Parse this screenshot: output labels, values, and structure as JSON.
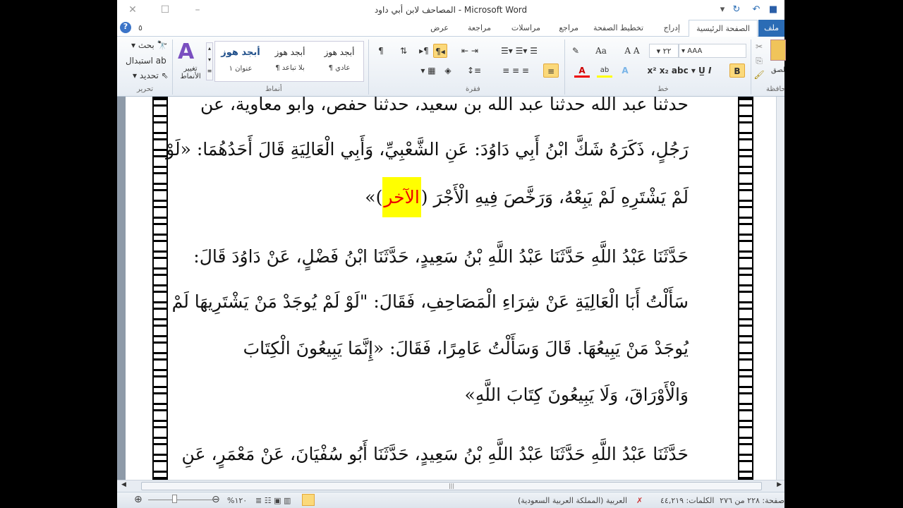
{
  "window": {
    "title": "المصاحف لابن أبي داود - Microsoft Word"
  },
  "tabs": [
    "ملف",
    "الصفحة الرئيسية",
    "إدراج",
    "تخطيط الصفحة",
    "مراجع",
    "مراسلات",
    "مراجعة",
    "عرض"
  ],
  "ribbon": {
    "editing": {
      "find": "بحث",
      "replace": "استبدال",
      "select": "تحديد",
      "label": "تحرير"
    },
    "styles": {
      "change_styles": "تغيير الأنماط",
      "label": "أنماط",
      "items": [
        {
          "sample": "أبجد هوز",
          "name": "¶ عادي"
        },
        {
          "sample": "أبجد هوز",
          "name": "¶ بلا تباعد"
        },
        {
          "sample": "أبجد هوز",
          "name": "عنوان ١"
        }
      ]
    },
    "paragraph": {
      "label": "فقرة"
    },
    "font": {
      "label": "خط",
      "name": "AAA GoldenLotus",
      "size": "٢٢"
    },
    "clipboard": {
      "label": "حافظة",
      "paste": "لصق"
    },
    "help_num": "٥"
  },
  "document": {
    "lines": [
      "حدثنا عبد الله حدثنا عبد الله بن سعيد، حدثنا حفص، وأبو معاوية، عن",
      "رَجُلٍ، ذَكَرَهُ شَكَّ ابْنُ أَبِي دَاوُدَ: عَنِ الشَّعْبِيِّ، وَأَبِي الْعَالِيَةِ قَالَ أَحَدُهُمَا: «لَوْ",
      "لَمْ يَشْتَرِهِ لَمْ يَبِعْهُ، وَرَخَّصَ فِيهِ الْأَجْرَ (",
      "حَدَّثَنَا عَبْدُ اللَّهِ حَدَّثَنَا عَبْدُ اللَّهِ بْنُ سَعِيدٍ، حَدَّثَنَا ابْنُ فَضْلٍ، عَنْ دَاوُدَ قَالَ:",
      "سَأَلْتُ أَبَا الْعَالِيَةِ عَنْ شِرَاءِ الْمَصَاحِفِ، فَقَالَ: \"لَوْ لَمْ يُوجَدْ مَنْ يَشْتَرِيهَا لَمْ",
      "يُوجَدْ مَنْ يَبِيعُهَا. قَالَ وَسَأَلْتُ عَامِرًا، فَقَالَ: «إِنَّمَا يَبِيعُونَ الْكِتَابَ",
      "وَالْأَوْرَاقَ، وَلَا يَبِيعُونَ كِتَابَ اللَّهِ»",
      "حَدَّثَنَا عَبْدُ اللَّهِ حَدَّثَنَا عَبْدُ اللَّهِ بْنُ سَعِيدٍ، حَدَّثَنَا أَبُو سُفْيَانَ، عَنْ مَعْمَرٍ، عَنِ"
    ],
    "highlight": "الآخر",
    "line3_end": ")»"
  },
  "status": {
    "page": "صفحة: ٢٢٨ من ٢٧٦",
    "words": "الكلمات: ٤٤,٢١٩",
    "language": "العربية (المملكة العربية السعودية)",
    "zoom": "%١٢٠"
  }
}
